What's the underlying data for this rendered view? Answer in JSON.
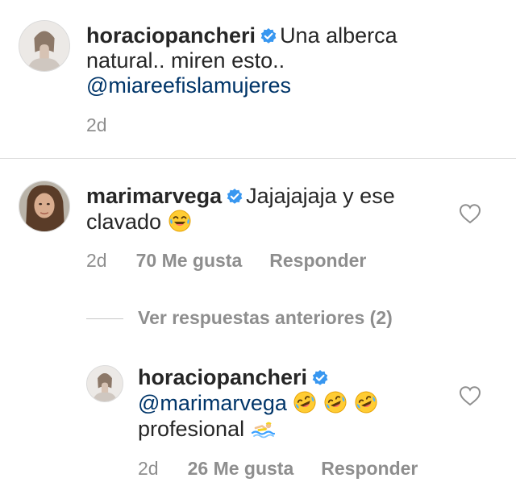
{
  "post": {
    "username": "horaciopancheri",
    "caption_text": "Una alberca natural.. miren esto..",
    "mention": "@miareefislamujeres",
    "time": "2d"
  },
  "comments": [
    {
      "username": "marimarvega",
      "text": "Jajajajaja y ese clavado",
      "emoji": "face-with-tears-of-joy",
      "time": "2d",
      "likes": "70 Me gusta",
      "reply_label": "Responder"
    }
  ],
  "view_previous_replies": "Ver respuestas anteriores (2)",
  "reply": {
    "username": "horaciopancheri",
    "mention": "@marimarvega",
    "emojis": [
      "rolling-on-floor-laughing",
      "rolling-on-floor-laughing",
      "rolling-on-floor-laughing"
    ],
    "text": "profesional",
    "trailing_emoji": "person-swimming",
    "time": "2d",
    "likes": "26 Me gusta",
    "reply_label": "Responder"
  },
  "colors": {
    "link": "#003569",
    "verified": "#3897f0",
    "secondary_text": "#8e8e8e",
    "divider": "#dbdbdb"
  }
}
